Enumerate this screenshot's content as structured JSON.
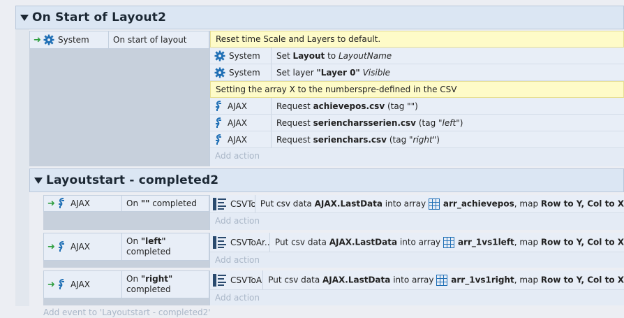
{
  "group1": {
    "title": "On Start of Layout2",
    "event": {
      "object": "System",
      "condition": "On start of layout",
      "actions": [
        {
          "type": "comment",
          "text": "Reset time Scale and Layers to default."
        },
        {
          "type": "action",
          "object": "System",
          "icon": "gear-icon",
          "parts": [
            "Set ",
            "Layout",
            " to ",
            "LayoutName"
          ]
        },
        {
          "type": "action",
          "object": "System",
          "icon": "gear-icon",
          "parts": [
            "Set layer ",
            "\"Layer 0\"",
            " ",
            "Visible"
          ]
        },
        {
          "type": "comment",
          "text": "Setting the array X to the numberspre-defined in the CSV"
        },
        {
          "type": "action",
          "object": "AJAX",
          "icon": "ajax-icon",
          "parts": [
            "Request ",
            "achievepos.csv",
            " (tag \"\")"
          ]
        },
        {
          "type": "action",
          "object": "AJAX",
          "icon": "ajax-icon",
          "parts": [
            "Request ",
            "serienchars​serien.csv",
            " (tag \"",
            "left",
            "\")"
          ]
        },
        {
          "type": "action",
          "object": "AJAX",
          "icon": "ajax-icon",
          "parts": [
            "Request ",
            "serienchars.csv",
            " (tag \"",
            "right",
            "\")"
          ]
        }
      ],
      "add_action": "Add action"
    }
  },
  "group2": {
    "title": "Layoutstart - completed2",
    "events": [
      {
        "object": "AJAX",
        "cond_pre": "On ",
        "cond_tag": "\"\"",
        "cond_post": " completed",
        "action_object": "CSVToAr...",
        "parts": [
          "Put csv data ",
          "AJAX.LastData",
          " into array ",
          "arr_achievepos",
          ", map ",
          "Row to Y, Col to X"
        ],
        "add_action": "Add action"
      },
      {
        "object": "AJAX",
        "cond_pre": "On ",
        "cond_tag": "\"left\"",
        "cond_post": "completed",
        "action_object": "CSVToAr...",
        "parts": [
          "Put csv data ",
          "AJAX.LastData",
          " into array ",
          "arr_1vs1left",
          ", map ",
          "Row to Y, Col to X"
        ],
        "add_action": "Add action"
      },
      {
        "object": "AJAX",
        "cond_pre": "On ",
        "cond_tag": "\"right\"",
        "cond_post": "completed",
        "action_object": "CSVToAr...",
        "parts": [
          "Put csv data ",
          "AJAX.LastData",
          " into array ",
          "arr_1vs1right",
          ", map ",
          "Row to Y, Col to X"
        ],
        "add_action": "Add action"
      }
    ],
    "add_event": "Add event to 'Layoutstart - completed2'"
  },
  "colors": {
    "header_bg": "#dbe6f3",
    "comment_bg": "#fefbc8",
    "icon_blue": "#1f6fb5",
    "arrow_green": "#2e9e3e"
  }
}
